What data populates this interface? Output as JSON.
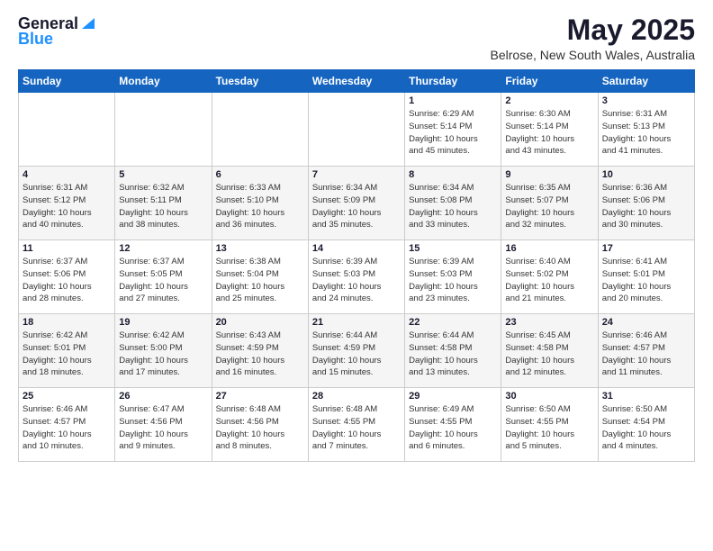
{
  "header": {
    "logo_general": "General",
    "logo_blue": "Blue",
    "title": "May 2025",
    "subtitle": "Belrose, New South Wales, Australia"
  },
  "weekdays": [
    "Sunday",
    "Monday",
    "Tuesday",
    "Wednesday",
    "Thursday",
    "Friday",
    "Saturday"
  ],
  "weeks": [
    [
      {
        "day": "",
        "info": ""
      },
      {
        "day": "",
        "info": ""
      },
      {
        "day": "",
        "info": ""
      },
      {
        "day": "",
        "info": ""
      },
      {
        "day": "1",
        "info": "Sunrise: 6:29 AM\nSunset: 5:14 PM\nDaylight: 10 hours\nand 45 minutes."
      },
      {
        "day": "2",
        "info": "Sunrise: 6:30 AM\nSunset: 5:14 PM\nDaylight: 10 hours\nand 43 minutes."
      },
      {
        "day": "3",
        "info": "Sunrise: 6:31 AM\nSunset: 5:13 PM\nDaylight: 10 hours\nand 41 minutes."
      }
    ],
    [
      {
        "day": "4",
        "info": "Sunrise: 6:31 AM\nSunset: 5:12 PM\nDaylight: 10 hours\nand 40 minutes."
      },
      {
        "day": "5",
        "info": "Sunrise: 6:32 AM\nSunset: 5:11 PM\nDaylight: 10 hours\nand 38 minutes."
      },
      {
        "day": "6",
        "info": "Sunrise: 6:33 AM\nSunset: 5:10 PM\nDaylight: 10 hours\nand 36 minutes."
      },
      {
        "day": "7",
        "info": "Sunrise: 6:34 AM\nSunset: 5:09 PM\nDaylight: 10 hours\nand 35 minutes."
      },
      {
        "day": "8",
        "info": "Sunrise: 6:34 AM\nSunset: 5:08 PM\nDaylight: 10 hours\nand 33 minutes."
      },
      {
        "day": "9",
        "info": "Sunrise: 6:35 AM\nSunset: 5:07 PM\nDaylight: 10 hours\nand 32 minutes."
      },
      {
        "day": "10",
        "info": "Sunrise: 6:36 AM\nSunset: 5:06 PM\nDaylight: 10 hours\nand 30 minutes."
      }
    ],
    [
      {
        "day": "11",
        "info": "Sunrise: 6:37 AM\nSunset: 5:06 PM\nDaylight: 10 hours\nand 28 minutes."
      },
      {
        "day": "12",
        "info": "Sunrise: 6:37 AM\nSunset: 5:05 PM\nDaylight: 10 hours\nand 27 minutes."
      },
      {
        "day": "13",
        "info": "Sunrise: 6:38 AM\nSunset: 5:04 PM\nDaylight: 10 hours\nand 25 minutes."
      },
      {
        "day": "14",
        "info": "Sunrise: 6:39 AM\nSunset: 5:03 PM\nDaylight: 10 hours\nand 24 minutes."
      },
      {
        "day": "15",
        "info": "Sunrise: 6:39 AM\nSunset: 5:03 PM\nDaylight: 10 hours\nand 23 minutes."
      },
      {
        "day": "16",
        "info": "Sunrise: 6:40 AM\nSunset: 5:02 PM\nDaylight: 10 hours\nand 21 minutes."
      },
      {
        "day": "17",
        "info": "Sunrise: 6:41 AM\nSunset: 5:01 PM\nDaylight: 10 hours\nand 20 minutes."
      }
    ],
    [
      {
        "day": "18",
        "info": "Sunrise: 6:42 AM\nSunset: 5:01 PM\nDaylight: 10 hours\nand 18 minutes."
      },
      {
        "day": "19",
        "info": "Sunrise: 6:42 AM\nSunset: 5:00 PM\nDaylight: 10 hours\nand 17 minutes."
      },
      {
        "day": "20",
        "info": "Sunrise: 6:43 AM\nSunset: 4:59 PM\nDaylight: 10 hours\nand 16 minutes."
      },
      {
        "day": "21",
        "info": "Sunrise: 6:44 AM\nSunset: 4:59 PM\nDaylight: 10 hours\nand 15 minutes."
      },
      {
        "day": "22",
        "info": "Sunrise: 6:44 AM\nSunset: 4:58 PM\nDaylight: 10 hours\nand 13 minutes."
      },
      {
        "day": "23",
        "info": "Sunrise: 6:45 AM\nSunset: 4:58 PM\nDaylight: 10 hours\nand 12 minutes."
      },
      {
        "day": "24",
        "info": "Sunrise: 6:46 AM\nSunset: 4:57 PM\nDaylight: 10 hours\nand 11 minutes."
      }
    ],
    [
      {
        "day": "25",
        "info": "Sunrise: 6:46 AM\nSunset: 4:57 PM\nDaylight: 10 hours\nand 10 minutes."
      },
      {
        "day": "26",
        "info": "Sunrise: 6:47 AM\nSunset: 4:56 PM\nDaylight: 10 hours\nand 9 minutes."
      },
      {
        "day": "27",
        "info": "Sunrise: 6:48 AM\nSunset: 4:56 PM\nDaylight: 10 hours\nand 8 minutes."
      },
      {
        "day": "28",
        "info": "Sunrise: 6:48 AM\nSunset: 4:55 PM\nDaylight: 10 hours\nand 7 minutes."
      },
      {
        "day": "29",
        "info": "Sunrise: 6:49 AM\nSunset: 4:55 PM\nDaylight: 10 hours\nand 6 minutes."
      },
      {
        "day": "30",
        "info": "Sunrise: 6:50 AM\nSunset: 4:55 PM\nDaylight: 10 hours\nand 5 minutes."
      },
      {
        "day": "31",
        "info": "Sunrise: 6:50 AM\nSunset: 4:54 PM\nDaylight: 10 hours\nand 4 minutes."
      }
    ]
  ]
}
